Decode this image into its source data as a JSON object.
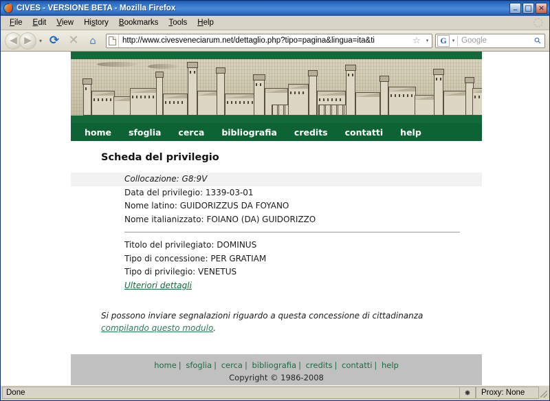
{
  "window": {
    "title": "CIVES - VERSIONE BETA - Mozilla Firefox",
    "minimize_label": "_",
    "maximize_label": "□",
    "close_label": "×"
  },
  "menubar": {
    "items": [
      {
        "label": "File",
        "accel": "F"
      },
      {
        "label": "Edit",
        "accel": "E"
      },
      {
        "label": "View",
        "accel": "V"
      },
      {
        "label": "History",
        "accel": "s"
      },
      {
        "label": "Bookmarks",
        "accel": "B"
      },
      {
        "label": "Tools",
        "accel": "T"
      },
      {
        "label": "Help",
        "accel": "H"
      }
    ]
  },
  "toolbar": {
    "back_glyph": "◀",
    "forward_glyph": "▶",
    "dropdown_glyph": "▾",
    "reload_glyph": "⟳",
    "stop_glyph": "✕",
    "home_glyph": "⌂",
    "url": "http://www.civesveneciarum.net/dettaglio.php?tipo=pagina&lingua=ita&ti",
    "star_glyph": "☆",
    "search_engine": "G",
    "search_placeholder": "Google",
    "search_glyph": "⚲"
  },
  "site": {
    "nav": [
      {
        "label": "home"
      },
      {
        "label": "sfoglia"
      },
      {
        "label": "cerca"
      },
      {
        "label": "bibliografia"
      },
      {
        "label": "credits"
      },
      {
        "label": "contatti"
      },
      {
        "label": "help"
      }
    ],
    "page_title": "Scheda del privilegio",
    "fields_group_1": [
      {
        "label": "Collocazione:",
        "value": "G8:9V"
      },
      {
        "label": "Data del privilegio:",
        "value": "1339-03-01"
      },
      {
        "label": "Nome latino:",
        "value": "GUIDORIZZUS DA FOYANO"
      },
      {
        "label": "Nome italianizzato:",
        "value": "FOIANO (DA) GUIDORIZZO"
      }
    ],
    "fields_group_2": [
      {
        "label": "Titolo del privilegiato:",
        "value": "DOMINUS"
      },
      {
        "label": "Tipo di concessione:",
        "value": "PER GRATIAM"
      },
      {
        "label": "Tipo di privilegio:",
        "value": "VENETUS"
      }
    ],
    "details_link": "Ulteriori dettagli",
    "note_prefix": "Si possono inviare segnalazioni riguardo a questa concessione di cittadinanza ",
    "note_link": "compilando questo modulo",
    "note_suffix": ".",
    "footer_links": [
      {
        "label": "home"
      },
      {
        "label": "sfoglia"
      },
      {
        "label": "cerca"
      },
      {
        "label": "bibliografia"
      },
      {
        "label": "credits"
      },
      {
        "label": "contatti"
      },
      {
        "label": "help"
      }
    ],
    "footer_separator": "|",
    "copyright": "Copyright © 1986-2008",
    "colors": {
      "nav_green": "#0d6334",
      "banner_green": "#14693b",
      "link_green": "#14693b",
      "field_band": "#f2f2f2",
      "footer_grey": "#c0c0c0"
    }
  },
  "statusbar": {
    "status": "Done",
    "icon_glyph": "✸",
    "proxy": "Proxy: None"
  }
}
